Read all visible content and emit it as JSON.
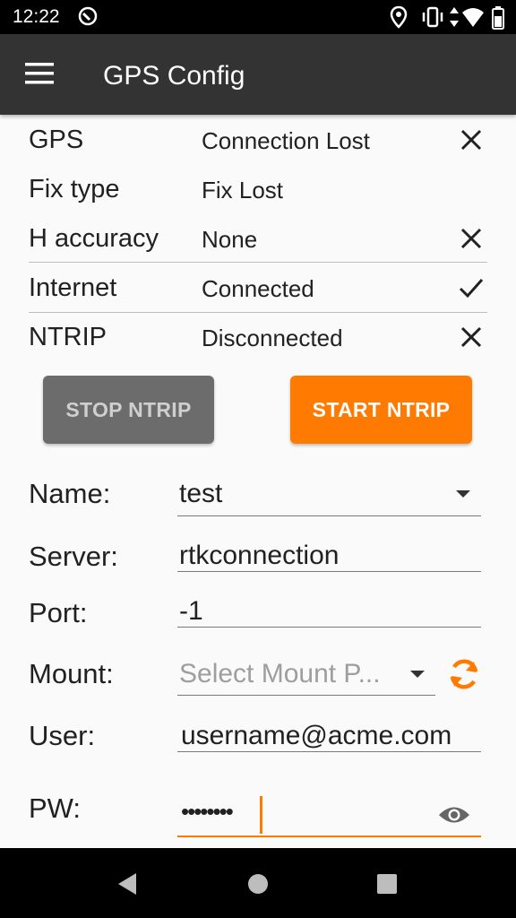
{
  "statusbar": {
    "time": "12:22"
  },
  "appbar": {
    "title": "GPS Config"
  },
  "status": {
    "gps": {
      "label": "GPS",
      "value": "Connection Lost",
      "icon": "close-icon"
    },
    "fix": {
      "label": "Fix type",
      "value": "Fix Lost"
    },
    "haccuracy": {
      "label": "H accuracy",
      "value": "None",
      "icon": "close-icon"
    },
    "internet": {
      "label": "Internet",
      "value": "Connected",
      "icon": "check-icon"
    },
    "ntrip": {
      "label": "NTRIP",
      "value": "Disconnected",
      "icon": "close-icon"
    }
  },
  "buttons": {
    "stop": "STOP NTRIP",
    "start": "START NTRIP"
  },
  "form": {
    "name": {
      "label": "Name:",
      "value": "test"
    },
    "server": {
      "label": "Server:",
      "value": "rtkconnection"
    },
    "port": {
      "label": "Port:",
      "value": "-1"
    },
    "mount": {
      "label": "Mount:",
      "placeholder": "Select Mount P..."
    },
    "user": {
      "label": "User:",
      "value": "username@acme.com"
    },
    "pw": {
      "label": "PW:",
      "value": "••••••••"
    }
  },
  "colors": {
    "accent": "#ff7a00",
    "appbar": "#333333",
    "stop_button": "#6c6c6c"
  }
}
